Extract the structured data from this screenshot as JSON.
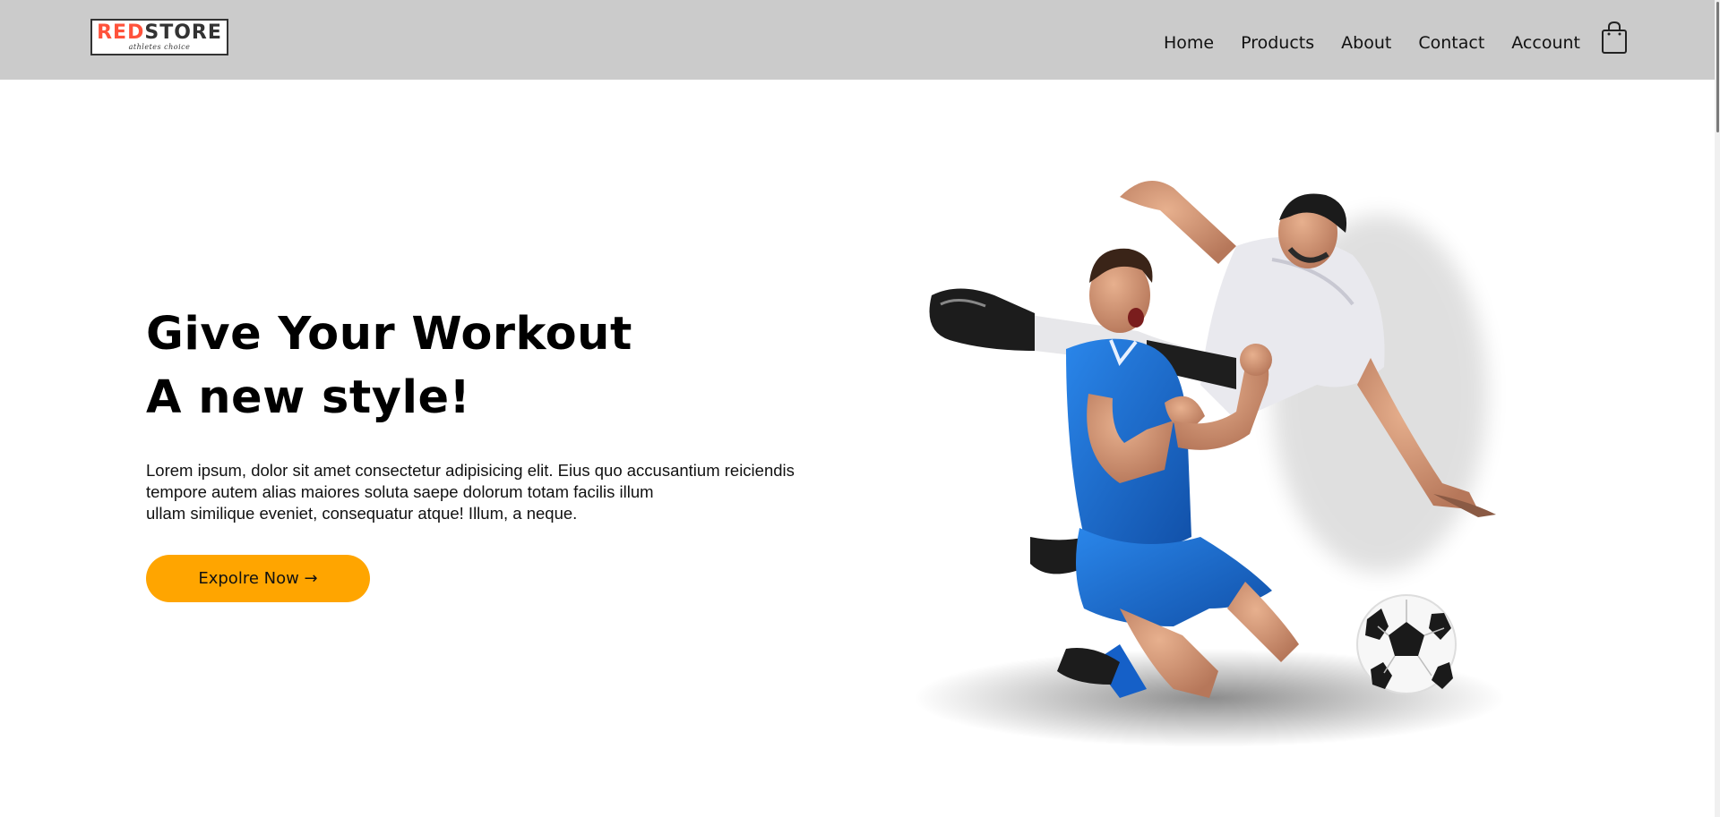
{
  "header": {
    "logo": {
      "part1": "RED",
      "part2": "STORE",
      "tagline": "athletes choice"
    },
    "nav": [
      {
        "label": "Home"
      },
      {
        "label": "Products"
      },
      {
        "label": "About"
      },
      {
        "label": "Contact"
      },
      {
        "label": "Account"
      }
    ],
    "cart_icon": "shopping-bag-icon"
  },
  "hero": {
    "title_line1": "Give Your Workout",
    "title_line2": "A new style!",
    "description_lines": [
      "Lorem ipsum, dolor sit amet consectetur adipisicing elit. Eius quo accusantium reiciendis",
      "tempore autem alias maiores soluta saepe dolorum totam facilis illum",
      "ullam similique eveniet, consequatur atque! Illum, a neque."
    ],
    "cta_label": "Expolre Now →",
    "image": "football-players-illustration"
  },
  "colors": {
    "header_bg": "#cbcbcb",
    "brand_red": "#ff523b",
    "button": "#ffa500",
    "jersey_blue": "#1d6fd1"
  }
}
